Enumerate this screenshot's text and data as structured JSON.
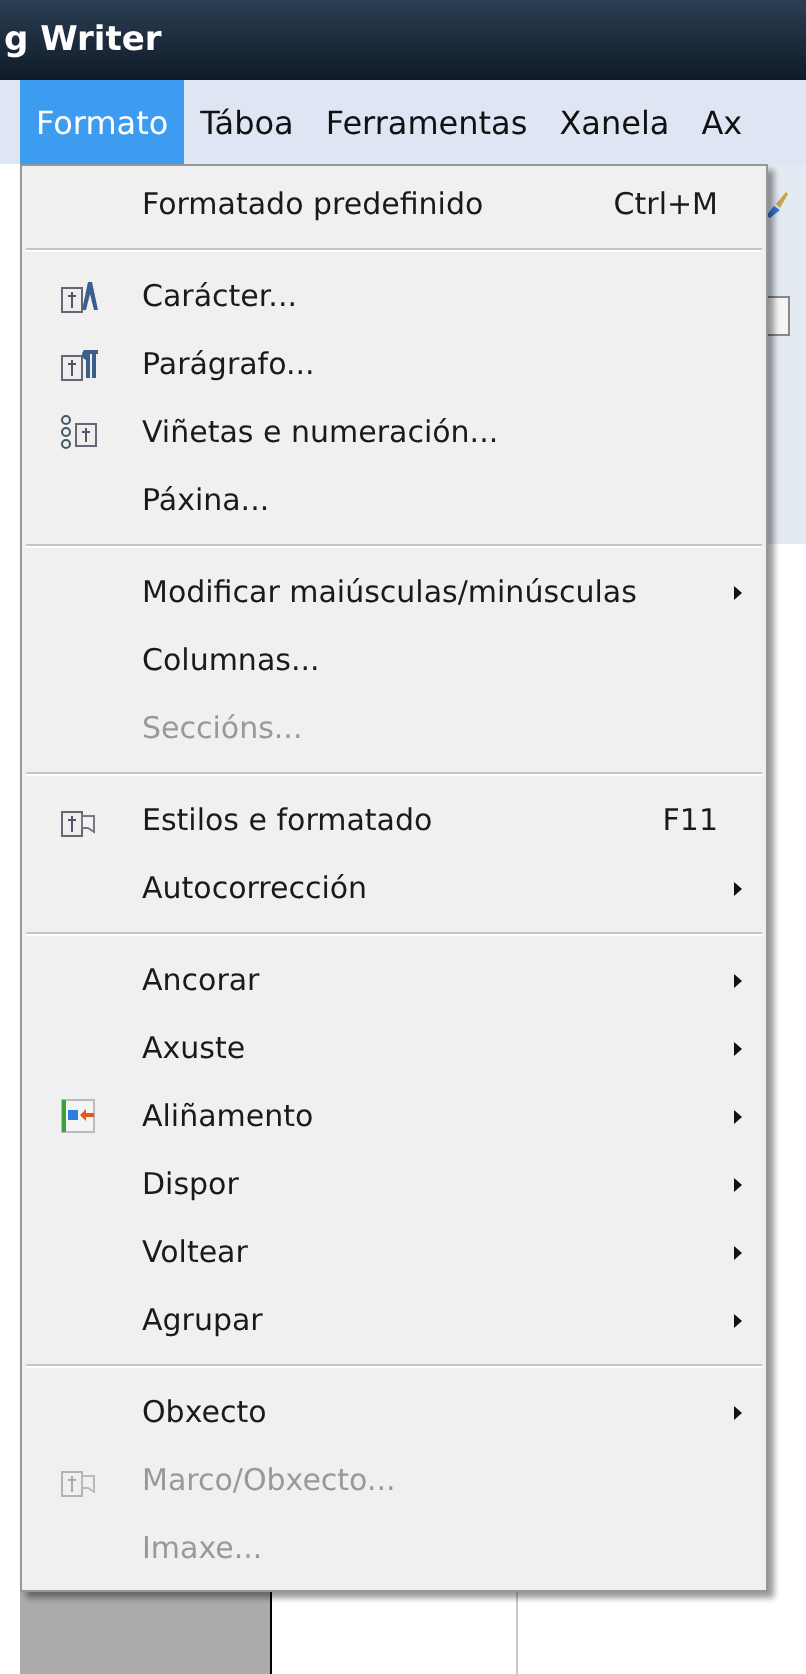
{
  "window": {
    "title": "g Writer"
  },
  "menubar": [
    {
      "label": "Formato",
      "selected": true
    },
    {
      "label": "Táboa",
      "selected": false
    },
    {
      "label": "Ferramentas",
      "selected": false
    },
    {
      "label": "Xanela",
      "selected": false
    },
    {
      "label": "Ax",
      "selected": false
    }
  ],
  "menu": [
    {
      "kind": "item",
      "label": "Formatado predefinido",
      "shortcut": "Ctrl+M",
      "disabled": false,
      "icon": false,
      "submenu": false
    },
    {
      "kind": "separator"
    },
    {
      "kind": "item",
      "label": "Carácter...",
      "disabled": false,
      "icon": true,
      "submenu": false
    },
    {
      "kind": "item",
      "label": "Parágrafo...",
      "disabled": false,
      "icon": true,
      "submenu": false
    },
    {
      "kind": "item",
      "label": "Viñetas e numeración...",
      "disabled": false,
      "icon": true,
      "submenu": false
    },
    {
      "kind": "item",
      "label": "Páxina...",
      "disabled": false,
      "icon": false,
      "submenu": false
    },
    {
      "kind": "separator"
    },
    {
      "kind": "item",
      "label": "Modificar maiúsculas/minúsculas",
      "disabled": false,
      "icon": false,
      "submenu": true
    },
    {
      "kind": "item",
      "label": "Columnas...",
      "disabled": false,
      "icon": false,
      "submenu": false
    },
    {
      "kind": "item",
      "label": "Seccións...",
      "disabled": true,
      "icon": false,
      "submenu": false
    },
    {
      "kind": "separator"
    },
    {
      "kind": "item",
      "label": "Estilos e formatado",
      "shortcut": "F11",
      "disabled": false,
      "icon": true,
      "submenu": false
    },
    {
      "kind": "item",
      "label": "Autocorrección",
      "disabled": false,
      "icon": false,
      "submenu": true
    },
    {
      "kind": "separator"
    },
    {
      "kind": "item",
      "label": "Ancorar",
      "disabled": false,
      "icon": false,
      "submenu": true
    },
    {
      "kind": "item",
      "label": "Axuste",
      "disabled": false,
      "icon": false,
      "submenu": true
    },
    {
      "kind": "item",
      "label": "Aliñamento",
      "disabled": false,
      "icon": true,
      "submenu": true
    },
    {
      "kind": "item",
      "label": "Dispor",
      "disabled": false,
      "icon": false,
      "submenu": true
    },
    {
      "kind": "item",
      "label": "Voltear",
      "disabled": false,
      "icon": false,
      "submenu": true
    },
    {
      "kind": "item",
      "label": "Agrupar",
      "disabled": false,
      "icon": false,
      "submenu": true
    },
    {
      "kind": "separator"
    },
    {
      "kind": "item",
      "label": "Obxecto",
      "disabled": false,
      "icon": false,
      "submenu": true
    },
    {
      "kind": "item",
      "label": "Marco/Obxecto...",
      "disabled": true,
      "icon": true,
      "submenu": false
    },
    {
      "kind": "item",
      "label": "Imaxe...",
      "disabled": true,
      "icon": false,
      "submenu": false
    }
  ]
}
